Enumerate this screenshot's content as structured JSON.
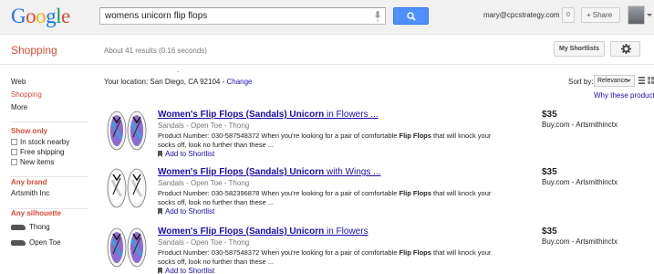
{
  "header": {
    "logo_letters": [
      {
        "char": "G",
        "color": "#1a73e8"
      },
      {
        "char": "o",
        "color": "#dd4b39"
      },
      {
        "char": "o",
        "color": "#f4b400"
      },
      {
        "char": "g",
        "color": "#1a73e8"
      },
      {
        "char": "l",
        "color": "#0f9d58"
      },
      {
        "char": "e",
        "color": "#dd4b39"
      }
    ],
    "search_query": "womens unicorn flip flops",
    "email": "mary@cpcstrategy.com",
    "notification_count": "0",
    "share_label": "+ Share",
    "icons": [
      "microphone-icon",
      "search-icon",
      "avatar"
    ]
  },
  "section": {
    "title": "Shopping",
    "result_count": "About 41 results (0.16 seconds)",
    "shortlist_button": "My Shortlists",
    "settings_icon": "gear-icon"
  },
  "left_nav": {
    "items": [
      {
        "label": "Web",
        "active": false
      },
      {
        "label": "Shopping",
        "active": true
      },
      {
        "label": "More",
        "active": false
      }
    ],
    "show_only": {
      "title": "Show only",
      "options": [
        "In stock nearby",
        "Free shipping",
        "New items"
      ]
    },
    "brand": {
      "title": "Any brand",
      "options": [
        "Artsmith Inc"
      ]
    },
    "silhouette": {
      "title": "Any silhouette",
      "options": [
        "Thong",
        "Open Toe"
      ]
    }
  },
  "location": {
    "prefix": "Your location: San Diego, CA 92104 - ",
    "change_link": "Change",
    "dot": "."
  },
  "sort": {
    "label": "Sort by:",
    "selected": "Relevance",
    "why_link": "Why these products?"
  },
  "results": [
    {
      "title_bold": "Women's Flip Flops (Sandals) Unicorn",
      "title_rest": " in Flowers ...",
      "category": "Sandals - Open Toe - Thong",
      "desc_pre": "Product Number: 030-587548372 When you're looking for a pair of comfortable ",
      "desc_bold": "Flip Flops",
      "desc_post": " that will knock your socks off, look no further than these ...",
      "shortlist": "Add to Shortlist",
      "price": "$35",
      "seller": "Buy.com - Artsmithinctx",
      "pattern": "flowers"
    },
    {
      "title_bold": "Women's Flip Flops (Sandals) Unicorn",
      "title_rest": " with Wings ...",
      "category": "Sandals - Open Toe - Thong",
      "desc_pre": "Product Number: 030-582396878 When you're looking for a pair of comfortable ",
      "desc_bold": "Flip Flops",
      "desc_post": " that will knock your socks off, look no further than these ...",
      "shortlist": "Add to Shortlist",
      "price": "$35",
      "seller": "Buy.com - Artsmithinctx",
      "pattern": "wings"
    },
    {
      "title_bold": "Women's Flip Flops (Sandals) Unicorn",
      "title_rest": " in Flowers",
      "category": "Sandals - Open Toe - Thong",
      "desc_pre": "Product Number: 030-587548372 When you're looking for a pair of comfortable ",
      "desc_bold": "Flip Flops",
      "desc_post": " that will knock your socks off, look no further than these ...",
      "shortlist": "Add to Shortlist",
      "price": "$35",
      "seller": "Buy.com - Artsmithinctx",
      "pattern": "flowers"
    }
  ],
  "colors": {
    "brand_red": "#dd4b39",
    "link_blue": "#1a0dab",
    "search_button": "#4d90fe"
  }
}
